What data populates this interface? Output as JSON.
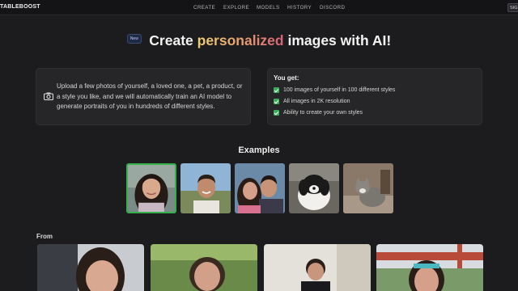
{
  "nav": {
    "logo": "TABLEBOOST",
    "items": [
      "CREATE",
      "EXPLORE",
      "MODELS",
      "HISTORY",
      "DISCORD"
    ],
    "signin": "SIG"
  },
  "hero": {
    "badge": "New",
    "title_pre": "Create ",
    "title_highlight": "personalized",
    "title_post": " images with AI!"
  },
  "intro": {
    "icon": "camera-icon",
    "text": "Upload a few photos of yourself, a loved one, a pet, a product, or a style you like, and we will automatically train an AI model to generate portraits of you in hundreds of different styles."
  },
  "features": {
    "heading": "You get:",
    "items": [
      "100 images of yourself in 100 different styles",
      "All images in 2K resolution",
      "Ability to create your own styles"
    ],
    "check_color": "#3cae5a"
  },
  "examples": {
    "title": "Examples",
    "selected_index": 0,
    "thumbs": [
      "woman-portrait",
      "man-selfie",
      "couple-selfie",
      "dog-photo",
      "cat-photo"
    ]
  },
  "from_section": {
    "label": "From"
  },
  "colors": {
    "background": "#1c1c1e",
    "card": "#262628",
    "selected_border": "#36b04a",
    "gradient": [
      "#f0d070",
      "#e8a070",
      "#d8607a"
    ]
  }
}
